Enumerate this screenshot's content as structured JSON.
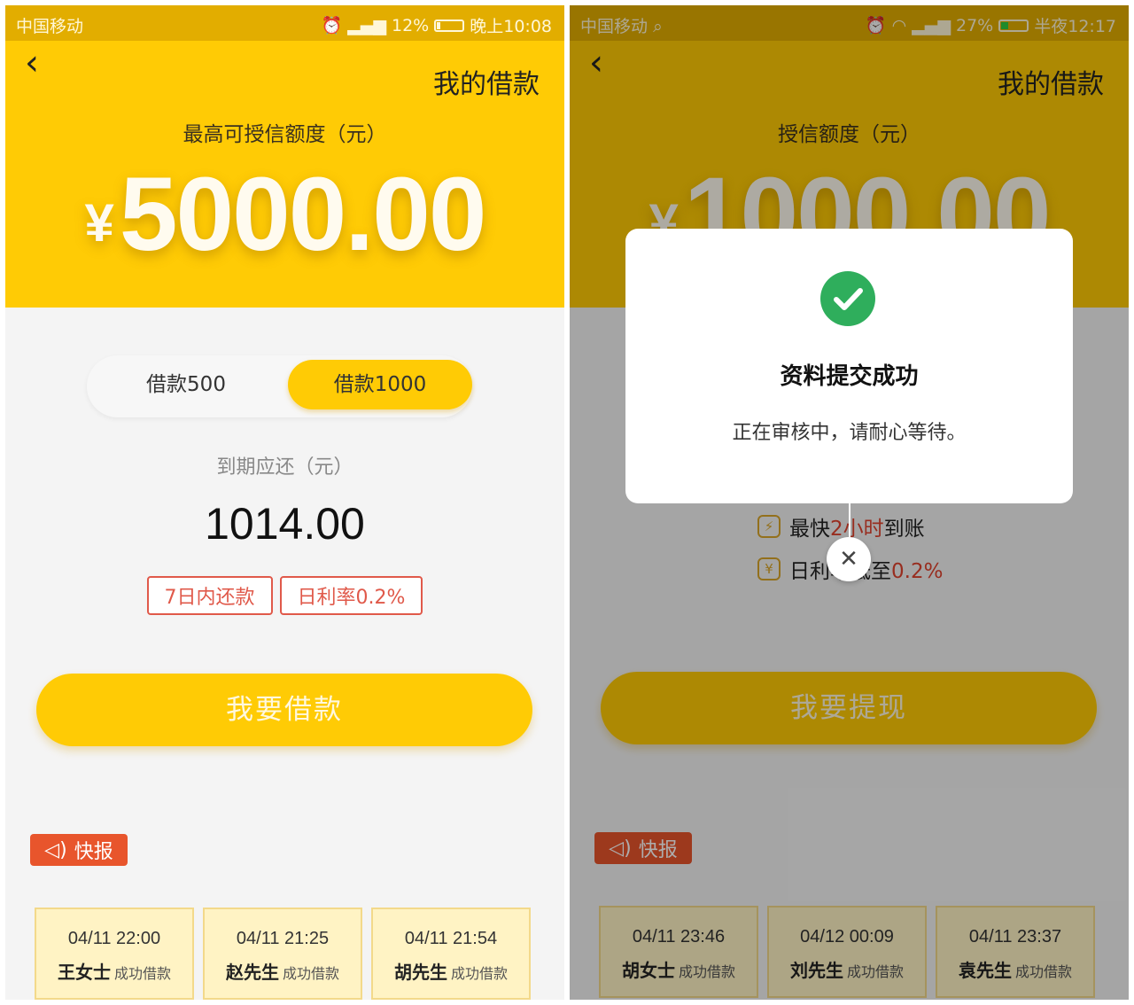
{
  "left": {
    "status": {
      "carrier": "中国移动",
      "battery": "12%",
      "time": "晚上10:08"
    },
    "header": {
      "title": "我的借款",
      "credit_label": "最高可授信额度（元）",
      "currency": "¥",
      "amount": "5000.00"
    },
    "tabs": [
      "借款500",
      "借款1000"
    ],
    "due_label": "到期应还（元）",
    "due_amount": "1014.00",
    "badges": [
      "7日内还款",
      "日利率0.2%"
    ],
    "button": "我要借款",
    "flash": "快报",
    "cards": [
      {
        "time": "04/11 22:00",
        "name": "王女士",
        "action": "成功借款"
      },
      {
        "time": "04/11 21:25",
        "name": "赵先生",
        "action": "成功借款"
      },
      {
        "time": "04/11 21:54",
        "name": "胡先生",
        "action": "成功借款"
      }
    ]
  },
  "right": {
    "status": {
      "carrier": "中国移动",
      "battery": "27%",
      "time": "半夜12:17"
    },
    "header": {
      "title": "我的借款",
      "credit_label": "授信额度（元）",
      "currency": "¥",
      "amount": "1000.00"
    },
    "features": {
      "f1_a": "最快",
      "f1_b": "2小时",
      "f1_c": "到账",
      "f2_a": "日利率低至",
      "f2_b": "0.2%"
    },
    "button": "我要提现",
    "flash": "快报",
    "cards": [
      {
        "time": "04/11 23:46",
        "name": "胡女士",
        "action": "成功借款"
      },
      {
        "time": "04/12 00:09",
        "name": "刘先生",
        "action": "成功借款"
      },
      {
        "time": "04/11 23:37",
        "name": "袁先生",
        "action": "成功借款"
      }
    ],
    "dialog": {
      "title": "资料提交成功",
      "message": "正在审核中，请耐心等待。"
    }
  }
}
